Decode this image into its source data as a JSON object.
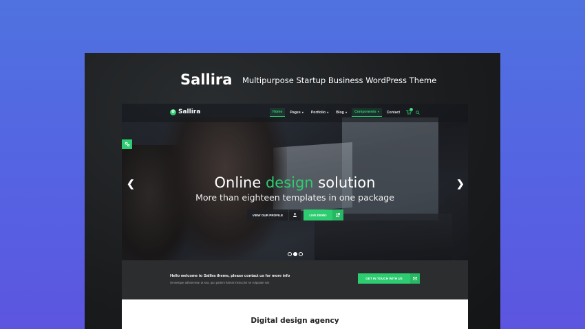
{
  "header": {
    "brand": "Sallira",
    "tagline": "Multipurpose Startup Business WordPress Theme"
  },
  "site": {
    "logo_text": "Sallira",
    "logo_icon": "leaf-icon",
    "nav": [
      {
        "label": "Home",
        "active": true,
        "dropdown": false
      },
      {
        "label": "Pages",
        "active": false,
        "dropdown": true
      },
      {
        "label": "Portfolio",
        "active": false,
        "dropdown": true
      },
      {
        "label": "Blog",
        "active": false,
        "dropdown": true
      },
      {
        "label": "Components",
        "active": false,
        "dropdown": true,
        "highlight": true
      },
      {
        "label": "Contact",
        "active": false,
        "dropdown": false
      }
    ],
    "cart_count": "0"
  },
  "hero": {
    "title_before": "Online ",
    "title_accent": "design",
    "title_after": " solution",
    "subtitle": "More than eighteen templates in one package",
    "btn_profile": "VIEW OUR PROFILE",
    "btn_demo": "LIVE DEMO",
    "slides": 3,
    "active_slide": 2
  },
  "banner": {
    "title": "Hello welcome to Sallira theme, please contact us for more info",
    "text": "Omnesque adhoemean at sea, quo partem fuisset instructior ne vulputate ruis",
    "button": "GET IN TOUCH WITH US"
  },
  "content": {
    "title": "Digital design agency"
  },
  "colors": {
    "accent": "#2ecc71",
    "background_top": "#4f72e0",
    "background_bottom": "#5c55e0"
  }
}
